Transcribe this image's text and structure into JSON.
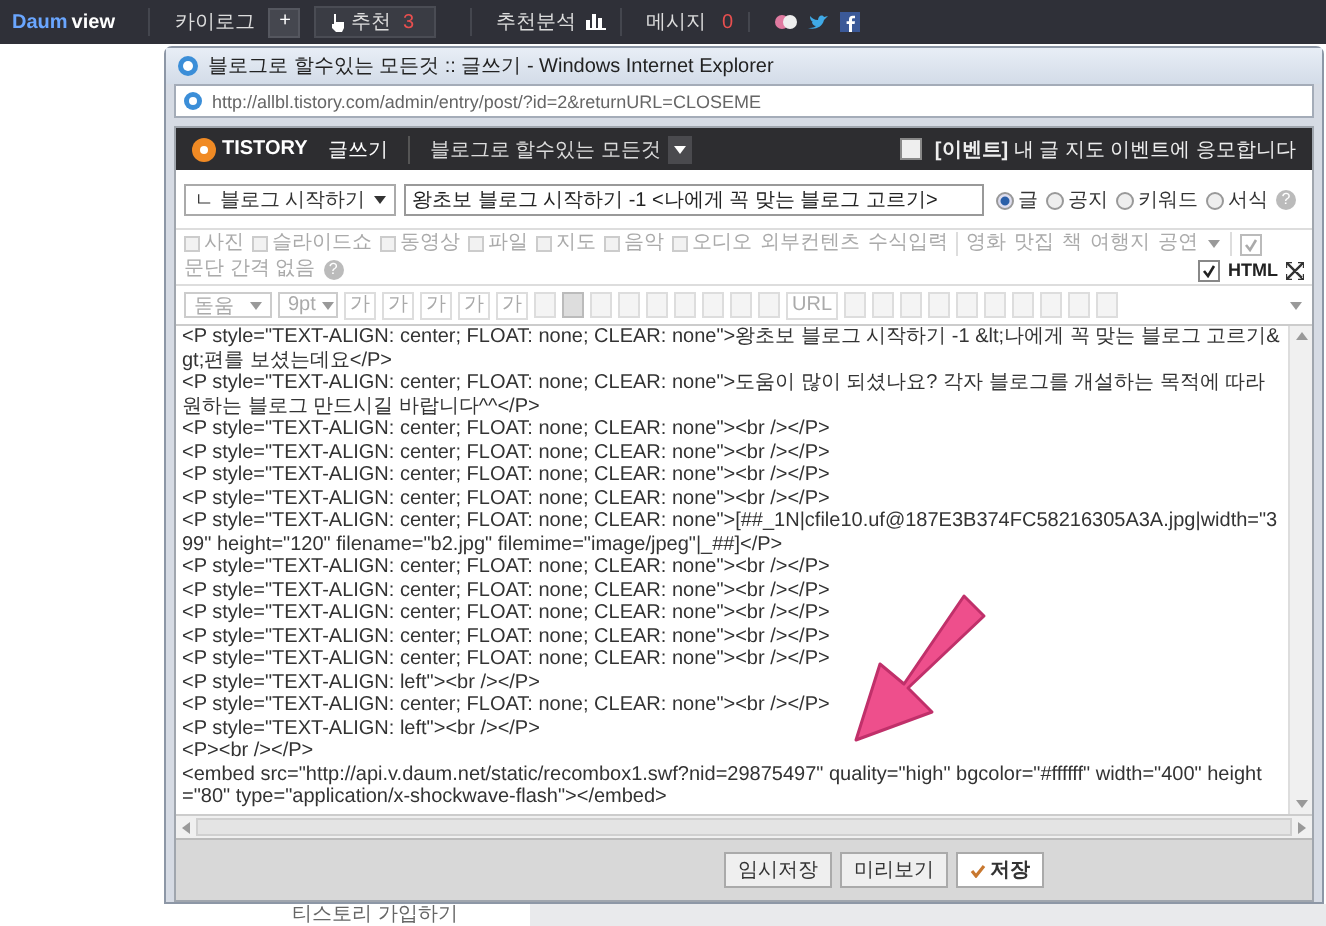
{
  "topbar": {
    "logo": {
      "brand": "Daum",
      "word": "view"
    },
    "items": [
      {
        "kind": "link",
        "label": "카이로그"
      },
      {
        "kind": "plus",
        "label": "+"
      },
      {
        "kind": "recommend",
        "label": "추천",
        "count": "3"
      },
      {
        "kind": "stats",
        "label": "추천분석"
      },
      {
        "kind": "message",
        "label": "메시지",
        "count": "0"
      },
      {
        "kind": "social"
      }
    ]
  },
  "window": {
    "title": "블로그로 할수있는 모든것 :: 글쓰기 - Windows Internet Explorer",
    "address": "http://allbl.tistory.com/admin/entry/post/?id=2&returnURL=CLOSEME",
    "header": {
      "logo": "TISTORY",
      "section": "글쓰기",
      "blog": "블로그로 할수있는 모든것",
      "event": {
        "checked": false,
        "label": "**[이벤트]** 내 글 지도 이벤트에 응모합니다"
      }
    },
    "post": {
      "category": "ㄴ 블로그 시작하기",
      "title": "왕초보 블로그 시작하기 -1 <나에게 꼭 맞는 블로그 고르기>",
      "types": [
        {
          "label": "글",
          "selected": true
        },
        {
          "label": "공지",
          "selected": false
        },
        {
          "label": "키워드",
          "selected": false
        },
        {
          "label": "서식",
          "selected": false
        }
      ],
      "help": "?"
    },
    "toolbar1": {
      "items": [
        "사진",
        "슬라이드쇼",
        "동영상",
        "파일",
        "지도",
        "음악",
        "오디오",
        "외부컨텐츠",
        "수식입력"
      ],
      "tags": [
        "영화",
        "맛집",
        "책",
        "여행지",
        "공연"
      ],
      "paragraph": {
        "label": "문단 간격 없음",
        "checked": true,
        "help": "?"
      },
      "html": {
        "label": "HTML",
        "checked": true
      }
    },
    "toolbar2": {
      "font": "돋움",
      "size": "9pt",
      "format": [
        "가",
        "가",
        "가",
        "가",
        "가"
      ],
      "url": "URL"
    },
    "editor": {
      "lines": [
        "<P style=\"TEXT-ALIGN: center; FLOAT: none; CLEAR: none\">왕초보 블로그 시작하기 -1 &lt;나에게 꼭 맞는 블로그 고르기&gt;편를 보셨는데요</P>",
        "<P style=\"TEXT-ALIGN: center; FLOAT: none; CLEAR: none\">도움이 많이 되셨나요? 각자 블로그를 개설하는 목적에 따라 원하는 블로그 만드시길 바랍니다^^</P>",
        "<P style=\"TEXT-ALIGN: center; FLOAT: none; CLEAR: none\"><br /></P>",
        "<P style=\"TEXT-ALIGN: center; FLOAT: none; CLEAR: none\"><br /></P>",
        "<P style=\"TEXT-ALIGN: center; FLOAT: none; CLEAR: none\"><br /></P>",
        "<P style=\"TEXT-ALIGN: center; FLOAT: none; CLEAR: none\"><br /></P>",
        "<P style=\"TEXT-ALIGN: center; FLOAT: none; CLEAR: none\">[##_1N|cfile10.uf@187E3B374FC58216305A3A.jpg|width=\"399\" height=\"120\" filename=\"b2.jpg\" filemime=\"image/jpeg\"|_##]</P>",
        "<P style=\"TEXT-ALIGN: center; FLOAT: none; CLEAR: none\"><br /></P>",
        "<P style=\"TEXT-ALIGN: center; FLOAT: none; CLEAR: none\"><br /></P>",
        "<P style=\"TEXT-ALIGN: center; FLOAT: none; CLEAR: none\"><br /></P>",
        "<P style=\"TEXT-ALIGN: center; FLOAT: none; CLEAR: none\"><br /></P>",
        "<P style=\"TEXT-ALIGN: center; FLOAT: none; CLEAR: none\"><br /></P>",
        "<P style=\"TEXT-ALIGN: left\"><br /></P>",
        "<P style=\"TEXT-ALIGN: center; FLOAT: none; CLEAR: none\"><br /></P>",
        "<P style=\"TEXT-ALIGN: left\"><br /></P>",
        "<P><br /></P>",
        "<embed src=\"http://api.v.daum.net/static/recombox1.swf?nid=29875497\" quality=\"high\" bgcolor=\"#ffffff\" width=\"400\" height=\"80\" type=\"application/x-shockwave-flash\"></embed>"
      ]
    },
    "buttons": [
      {
        "kind": "plain",
        "label": "임시저장"
      },
      {
        "kind": "plain",
        "label": "미리보기"
      },
      {
        "kind": "primary",
        "label": "저장"
      }
    ]
  },
  "below": {
    "link": "티스토리 가입하기"
  }
}
